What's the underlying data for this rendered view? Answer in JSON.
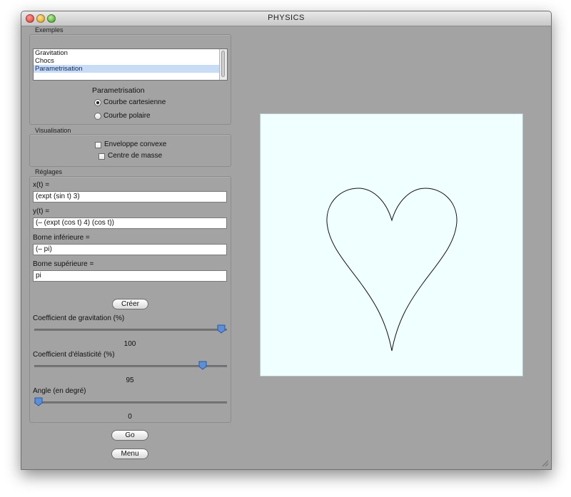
{
  "window": {
    "title": "PHYSICS"
  },
  "exemples": {
    "label": "Exemples",
    "list": [
      "Gravitation",
      "Chocs",
      "Parametrisation"
    ],
    "selected_index": 2,
    "param_title": "Parametrisation",
    "options": [
      "Courbe cartesienne",
      "Courbe polaire"
    ],
    "selected_option": 0
  },
  "visualisation": {
    "label": "Visualisation",
    "checks": [
      "Enveloppe convexe",
      "Centre de masse"
    ]
  },
  "reglages": {
    "label": "Réglages",
    "fields": [
      {
        "label": "x(t) =",
        "value": "(expt (sin t) 3)"
      },
      {
        "label": "y(t) =",
        "value": "(– (expt (cos t) 4) (cos t))"
      },
      {
        "label": "Borne inférieure =",
        "value": "(– pi)"
      },
      {
        "label": "Borne supérieure =",
        "value": "pi"
      }
    ],
    "create_label": "Créer",
    "sliders": [
      {
        "label": "Coefficient de gravitation (%)",
        "value": "100",
        "fraction": 1.0
      },
      {
        "label": "Coefficient d'élasticité (%)",
        "value": "95",
        "fraction": 0.89
      },
      {
        "label": "Angle (en degré)",
        "value": "0",
        "fraction": 0.0
      }
    ]
  },
  "buttons": {
    "go": "Go",
    "menu": "Menu"
  },
  "colors": {
    "canvas_bg": "#f0ffff",
    "selection": "#c8dcf6",
    "window_bg": "#a3a3a3"
  }
}
